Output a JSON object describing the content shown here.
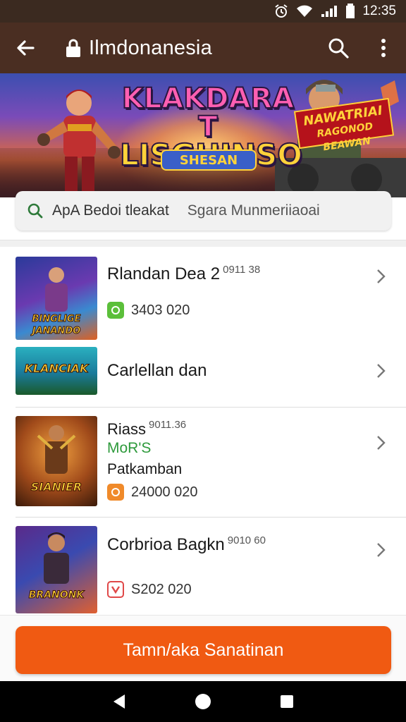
{
  "status_bar": {
    "time": "12:35"
  },
  "app_bar": {
    "title": "Ilmdonanesia"
  },
  "banner": {
    "logo_line1": "KLAKDARA T",
    "logo_line2": "LISGHINSO",
    "logo_sub": "SHESAN",
    "badge_line1": "NAWATRIAI",
    "badge_line2": "RAGONOD BEAWAN"
  },
  "search": {
    "placeholder_main": "ApA Bedoi tleakat",
    "placeholder_secondary": "Sgara Munmeriiaoai"
  },
  "list": [
    {
      "thumb_text": "BINGLIGE JANANDO",
      "name": "Rlandan Dea 2",
      "sup": "0911 38",
      "green": "",
      "sub": "",
      "price": "3403 020",
      "price_icon_color": "#5bbf3a"
    },
    {
      "thumb_text": "KLANCIAK",
      "name": "Carlellan dan",
      "sup": "",
      "green": "",
      "sub": "",
      "price": "",
      "price_icon_color": ""
    },
    {
      "thumb_text": "SIANIER",
      "name": "Riass",
      "sup": "9011.36",
      "green": "MoR'S",
      "sub": "Patkamban",
      "price": "24000 020",
      "price_icon_color": "#f08a2a"
    },
    {
      "thumb_text": "BRANONK",
      "name": "Corbrioa Bagkn",
      "sup": "9010 60",
      "green": "",
      "sub": "",
      "price": "S202 020",
      "price_icon_color": "#e04848"
    }
  ],
  "cta": {
    "label": "Tamn/aka Sanatinan"
  },
  "colors": {
    "app_bar": "#4a2e22",
    "accent": "#f05a12",
    "green": "#2e9a3c"
  },
  "icons": [
    "back-arrow-icon",
    "lock-icon",
    "search-icon",
    "more-vert-icon",
    "chevron-right-icon"
  ]
}
